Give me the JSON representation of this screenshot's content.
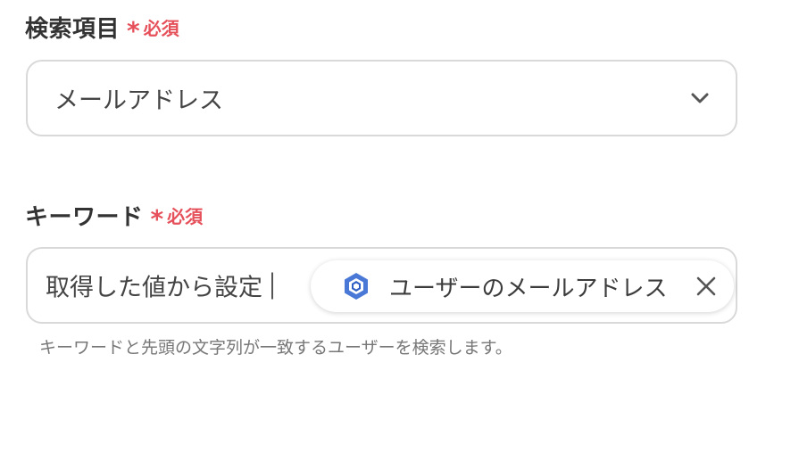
{
  "search_field": {
    "label": "検索項目",
    "required": "必須",
    "required_star": "*",
    "selected_value": "メールアドレス"
  },
  "keyword_field": {
    "label": "キーワード",
    "required": "必須",
    "required_star": "*",
    "text_value": "取得した値から設定",
    "chip_label": "ユーザーのメールアドレス",
    "help_text": "キーワードと先頭の文字列が一致するユーザーを検索します。"
  },
  "icons": {
    "dropdown": "chevron-down-icon",
    "chip_service": "google-workspace-icon",
    "chip_remove": "close-icon"
  },
  "colors": {
    "required": "#e5505a",
    "border": "#d9d9d9",
    "text": "#444444",
    "help": "#777777",
    "icon_blue": "#4a78d6"
  }
}
